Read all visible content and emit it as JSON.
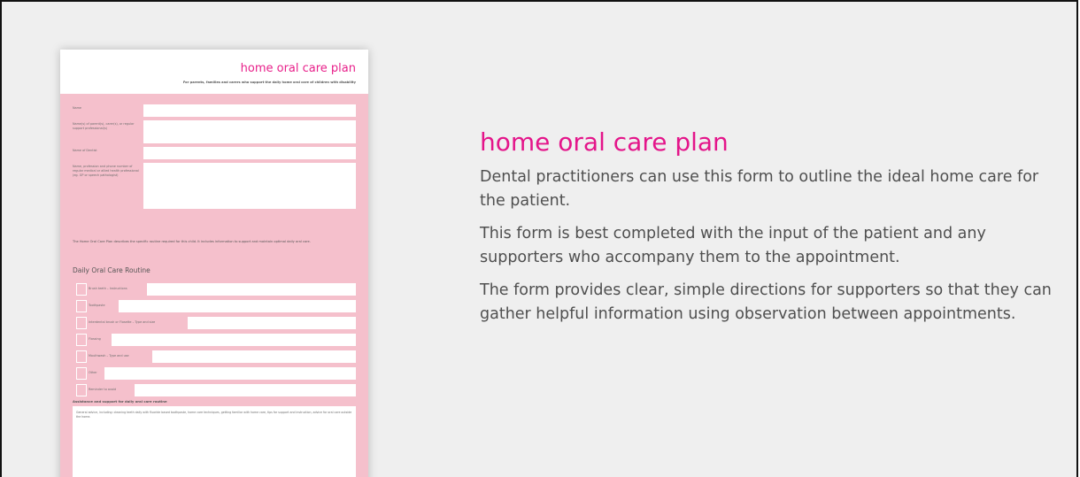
{
  "heading": "home oral care plan",
  "paragraphs": [
    "Dental practitioners can use this form to outline the ideal home care for the patient.",
    "This form is best completed with the input of the patient and any supporters who accompany them to the appointment.",
    "The form provides clear, simple directions for supporters so that they can gather helpful information using observation between appointments."
  ],
  "form_thumbnail": {
    "title": "home oral care plan",
    "subtitle": "For parents, families and carers who support the daily home oral care of children with disability",
    "fields": [
      "Name",
      "Name(s) of parent(s), carer(s), or regular support professional(s)",
      "Name of Dentist",
      "Name, profession and phone number of regular medical or allied health professional (eg. GP or speech pathologist)"
    ],
    "note": "The Home Oral Care Plan describes the specific routine required for this child. It includes information to support and maintain optimal daily oral care.",
    "routine_heading": "Daily Oral Care Routine",
    "routine_items": [
      "Brush teeth – Instructions",
      "Toothpaste",
      "Interdental brush or Flosette – Type and size",
      "Flossing",
      "Mouthwash – Type and use",
      "Other",
      "Reminder to avoid"
    ],
    "assistance_heading": "Assistance and support for daily oral care routine",
    "assistance_text": "General advice, including: cleaning teeth daily with fluoride based toothpaste, home care techniques, getting familiar with home care, tips for support and instruction, advice for oral care outside the home."
  },
  "colors": {
    "accent": "#e4158a",
    "form_pink": "#f5c0cc",
    "body_text": "#4f4f4f",
    "background": "#efefef"
  }
}
